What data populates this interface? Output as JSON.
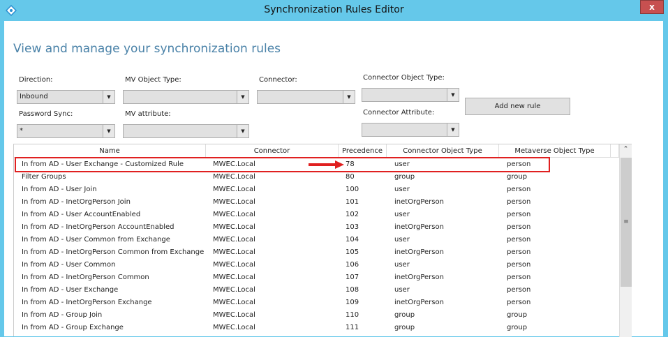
{
  "window": {
    "title": "Synchronization Rules Editor",
    "close_label": "x"
  },
  "heading": "View and manage your synchronization rules",
  "filters": {
    "direction": {
      "label": "Direction:",
      "value": "Inbound"
    },
    "mv_object_type": {
      "label": "MV Object Type:",
      "value": ""
    },
    "connector": {
      "label": "Connector:",
      "value": ""
    },
    "connector_object_type": {
      "label": "Connector Object Type:",
      "value": ""
    },
    "password_sync": {
      "label": "Password Sync:",
      "value": "*"
    },
    "mv_attribute": {
      "label": "MV attribute:",
      "value": ""
    },
    "connector_attribute": {
      "label": "Connector Attribute:",
      "value": ""
    }
  },
  "add_button": "Add new rule",
  "table": {
    "columns": [
      "Name",
      "Connector",
      "Precedence",
      "Connector Object Type",
      "Metaverse Object Type"
    ],
    "rows": [
      [
        "In from AD - User Exchange - Customized Rule",
        "MWEC.Local",
        "78",
        "user",
        "person"
      ],
      [
        "Filter Groups",
        "MWEC.Local",
        "80",
        "group",
        "group"
      ],
      [
        "In from AD - User Join",
        "MWEC.Local",
        "100",
        "user",
        "person"
      ],
      [
        "In from AD - InetOrgPerson Join",
        "MWEC.Local",
        "101",
        "inetOrgPerson",
        "person"
      ],
      [
        "In from AD - User AccountEnabled",
        "MWEC.Local",
        "102",
        "user",
        "person"
      ],
      [
        "In from AD - InetOrgPerson AccountEnabled",
        "MWEC.Local",
        "103",
        "inetOrgPerson",
        "person"
      ],
      [
        "In from AD - User Common from Exchange",
        "MWEC.Local",
        "104",
        "user",
        "person"
      ],
      [
        "In from AD - InetOrgPerson Common from Exchange",
        "MWEC.Local",
        "105",
        "inetOrgPerson",
        "person"
      ],
      [
        "In from AD - User Common",
        "MWEC.Local",
        "106",
        "user",
        "person"
      ],
      [
        "In from AD - InetOrgPerson Common",
        "MWEC.Local",
        "107",
        "inetOrgPerson",
        "person"
      ],
      [
        "In from AD - User Exchange",
        "MWEC.Local",
        "108",
        "user",
        "person"
      ],
      [
        "In from AD - InetOrgPerson Exchange",
        "MWEC.Local",
        "109",
        "inetOrgPerson",
        "person"
      ],
      [
        "In from AD - Group Join",
        "MWEC.Local",
        "110",
        "group",
        "group"
      ],
      [
        "In from AD - Group Exchange",
        "MWEC.Local",
        "111",
        "group",
        "group"
      ]
    ]
  },
  "colors": {
    "titlebar": "#65c8ea",
    "highlight": "#e02020",
    "heading": "#4a82a8"
  }
}
